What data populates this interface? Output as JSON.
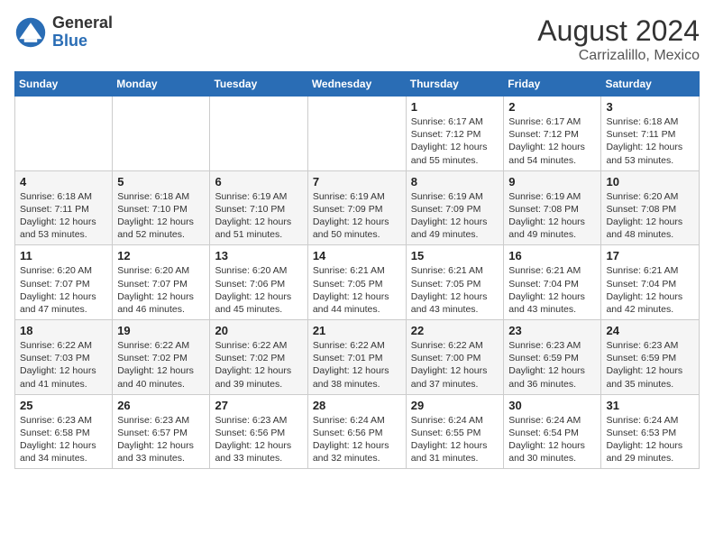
{
  "header": {
    "logo_general": "General",
    "logo_blue": "Blue",
    "month_year": "August 2024",
    "location": "Carrizalillo, Mexico"
  },
  "days_of_week": [
    "Sunday",
    "Monday",
    "Tuesday",
    "Wednesday",
    "Thursday",
    "Friday",
    "Saturday"
  ],
  "weeks": [
    [
      {
        "day": "",
        "info": ""
      },
      {
        "day": "",
        "info": ""
      },
      {
        "day": "",
        "info": ""
      },
      {
        "day": "",
        "info": ""
      },
      {
        "day": "1",
        "info": "Sunrise: 6:17 AM\nSunset: 7:12 PM\nDaylight: 12 hours\nand 55 minutes."
      },
      {
        "day": "2",
        "info": "Sunrise: 6:17 AM\nSunset: 7:12 PM\nDaylight: 12 hours\nand 54 minutes."
      },
      {
        "day": "3",
        "info": "Sunrise: 6:18 AM\nSunset: 7:11 PM\nDaylight: 12 hours\nand 53 minutes."
      }
    ],
    [
      {
        "day": "4",
        "info": "Sunrise: 6:18 AM\nSunset: 7:11 PM\nDaylight: 12 hours\nand 53 minutes."
      },
      {
        "day": "5",
        "info": "Sunrise: 6:18 AM\nSunset: 7:10 PM\nDaylight: 12 hours\nand 52 minutes."
      },
      {
        "day": "6",
        "info": "Sunrise: 6:19 AM\nSunset: 7:10 PM\nDaylight: 12 hours\nand 51 minutes."
      },
      {
        "day": "7",
        "info": "Sunrise: 6:19 AM\nSunset: 7:09 PM\nDaylight: 12 hours\nand 50 minutes."
      },
      {
        "day": "8",
        "info": "Sunrise: 6:19 AM\nSunset: 7:09 PM\nDaylight: 12 hours\nand 49 minutes."
      },
      {
        "day": "9",
        "info": "Sunrise: 6:19 AM\nSunset: 7:08 PM\nDaylight: 12 hours\nand 49 minutes."
      },
      {
        "day": "10",
        "info": "Sunrise: 6:20 AM\nSunset: 7:08 PM\nDaylight: 12 hours\nand 48 minutes."
      }
    ],
    [
      {
        "day": "11",
        "info": "Sunrise: 6:20 AM\nSunset: 7:07 PM\nDaylight: 12 hours\nand 47 minutes."
      },
      {
        "day": "12",
        "info": "Sunrise: 6:20 AM\nSunset: 7:07 PM\nDaylight: 12 hours\nand 46 minutes."
      },
      {
        "day": "13",
        "info": "Sunrise: 6:20 AM\nSunset: 7:06 PM\nDaylight: 12 hours\nand 45 minutes."
      },
      {
        "day": "14",
        "info": "Sunrise: 6:21 AM\nSunset: 7:05 PM\nDaylight: 12 hours\nand 44 minutes."
      },
      {
        "day": "15",
        "info": "Sunrise: 6:21 AM\nSunset: 7:05 PM\nDaylight: 12 hours\nand 43 minutes."
      },
      {
        "day": "16",
        "info": "Sunrise: 6:21 AM\nSunset: 7:04 PM\nDaylight: 12 hours\nand 43 minutes."
      },
      {
        "day": "17",
        "info": "Sunrise: 6:21 AM\nSunset: 7:04 PM\nDaylight: 12 hours\nand 42 minutes."
      }
    ],
    [
      {
        "day": "18",
        "info": "Sunrise: 6:22 AM\nSunset: 7:03 PM\nDaylight: 12 hours\nand 41 minutes."
      },
      {
        "day": "19",
        "info": "Sunrise: 6:22 AM\nSunset: 7:02 PM\nDaylight: 12 hours\nand 40 minutes."
      },
      {
        "day": "20",
        "info": "Sunrise: 6:22 AM\nSunset: 7:02 PM\nDaylight: 12 hours\nand 39 minutes."
      },
      {
        "day": "21",
        "info": "Sunrise: 6:22 AM\nSunset: 7:01 PM\nDaylight: 12 hours\nand 38 minutes."
      },
      {
        "day": "22",
        "info": "Sunrise: 6:22 AM\nSunset: 7:00 PM\nDaylight: 12 hours\nand 37 minutes."
      },
      {
        "day": "23",
        "info": "Sunrise: 6:23 AM\nSunset: 6:59 PM\nDaylight: 12 hours\nand 36 minutes."
      },
      {
        "day": "24",
        "info": "Sunrise: 6:23 AM\nSunset: 6:59 PM\nDaylight: 12 hours\nand 35 minutes."
      }
    ],
    [
      {
        "day": "25",
        "info": "Sunrise: 6:23 AM\nSunset: 6:58 PM\nDaylight: 12 hours\nand 34 minutes."
      },
      {
        "day": "26",
        "info": "Sunrise: 6:23 AM\nSunset: 6:57 PM\nDaylight: 12 hours\nand 33 minutes."
      },
      {
        "day": "27",
        "info": "Sunrise: 6:23 AM\nSunset: 6:56 PM\nDaylight: 12 hours\nand 33 minutes."
      },
      {
        "day": "28",
        "info": "Sunrise: 6:24 AM\nSunset: 6:56 PM\nDaylight: 12 hours\nand 32 minutes."
      },
      {
        "day": "29",
        "info": "Sunrise: 6:24 AM\nSunset: 6:55 PM\nDaylight: 12 hours\nand 31 minutes."
      },
      {
        "day": "30",
        "info": "Sunrise: 6:24 AM\nSunset: 6:54 PM\nDaylight: 12 hours\nand 30 minutes."
      },
      {
        "day": "31",
        "info": "Sunrise: 6:24 AM\nSunset: 6:53 PM\nDaylight: 12 hours\nand 29 minutes."
      }
    ]
  ]
}
